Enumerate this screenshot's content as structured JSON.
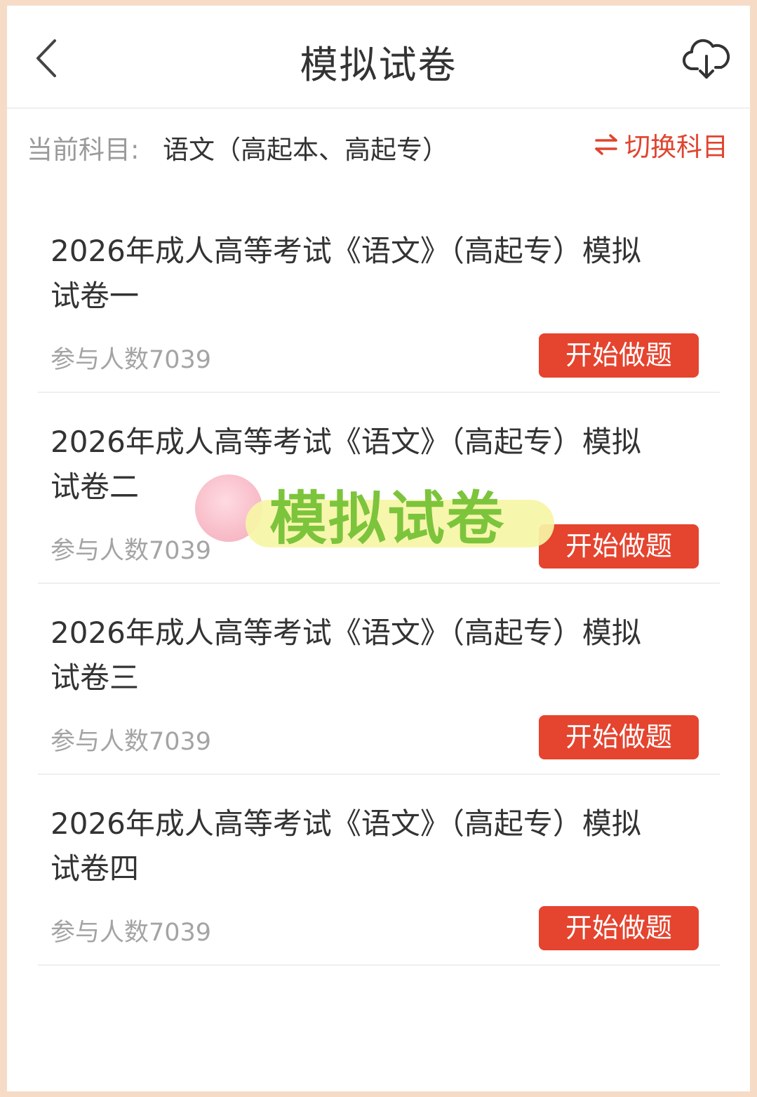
{
  "header": {
    "title": "模拟试卷",
    "back_icon": "chevron-left-icon",
    "download_icon": "cloud-download-icon"
  },
  "subject": {
    "label": "当前科目:",
    "value": "语文（高起本、高起专）",
    "switch_label": "切换科目",
    "switch_icon": "swap-arrows-icon"
  },
  "exams": [
    {
      "title": "2026年成人高等考试《语文》（高起专）模拟试卷一",
      "count": "参与人数7039",
      "button": "开始做题"
    },
    {
      "title": "2026年成人高等考试《语文》（高起专）模拟试卷二",
      "count": "参与人数7039",
      "button": "开始做题"
    },
    {
      "title": "2026年成人高等考试《语文》（高起专）模拟试卷三",
      "count": "参与人数7039",
      "button": "开始做题"
    },
    {
      "title": "2026年成人高等考试《语文》（高起专）模拟试卷四",
      "count": "参与人数7039",
      "button": "开始做题"
    }
  ],
  "watermark": {
    "text": "模拟试卷"
  },
  "colors": {
    "accent": "#e5442f",
    "frame": "#f6dcc6",
    "watermark_text": "#7cc43c"
  }
}
